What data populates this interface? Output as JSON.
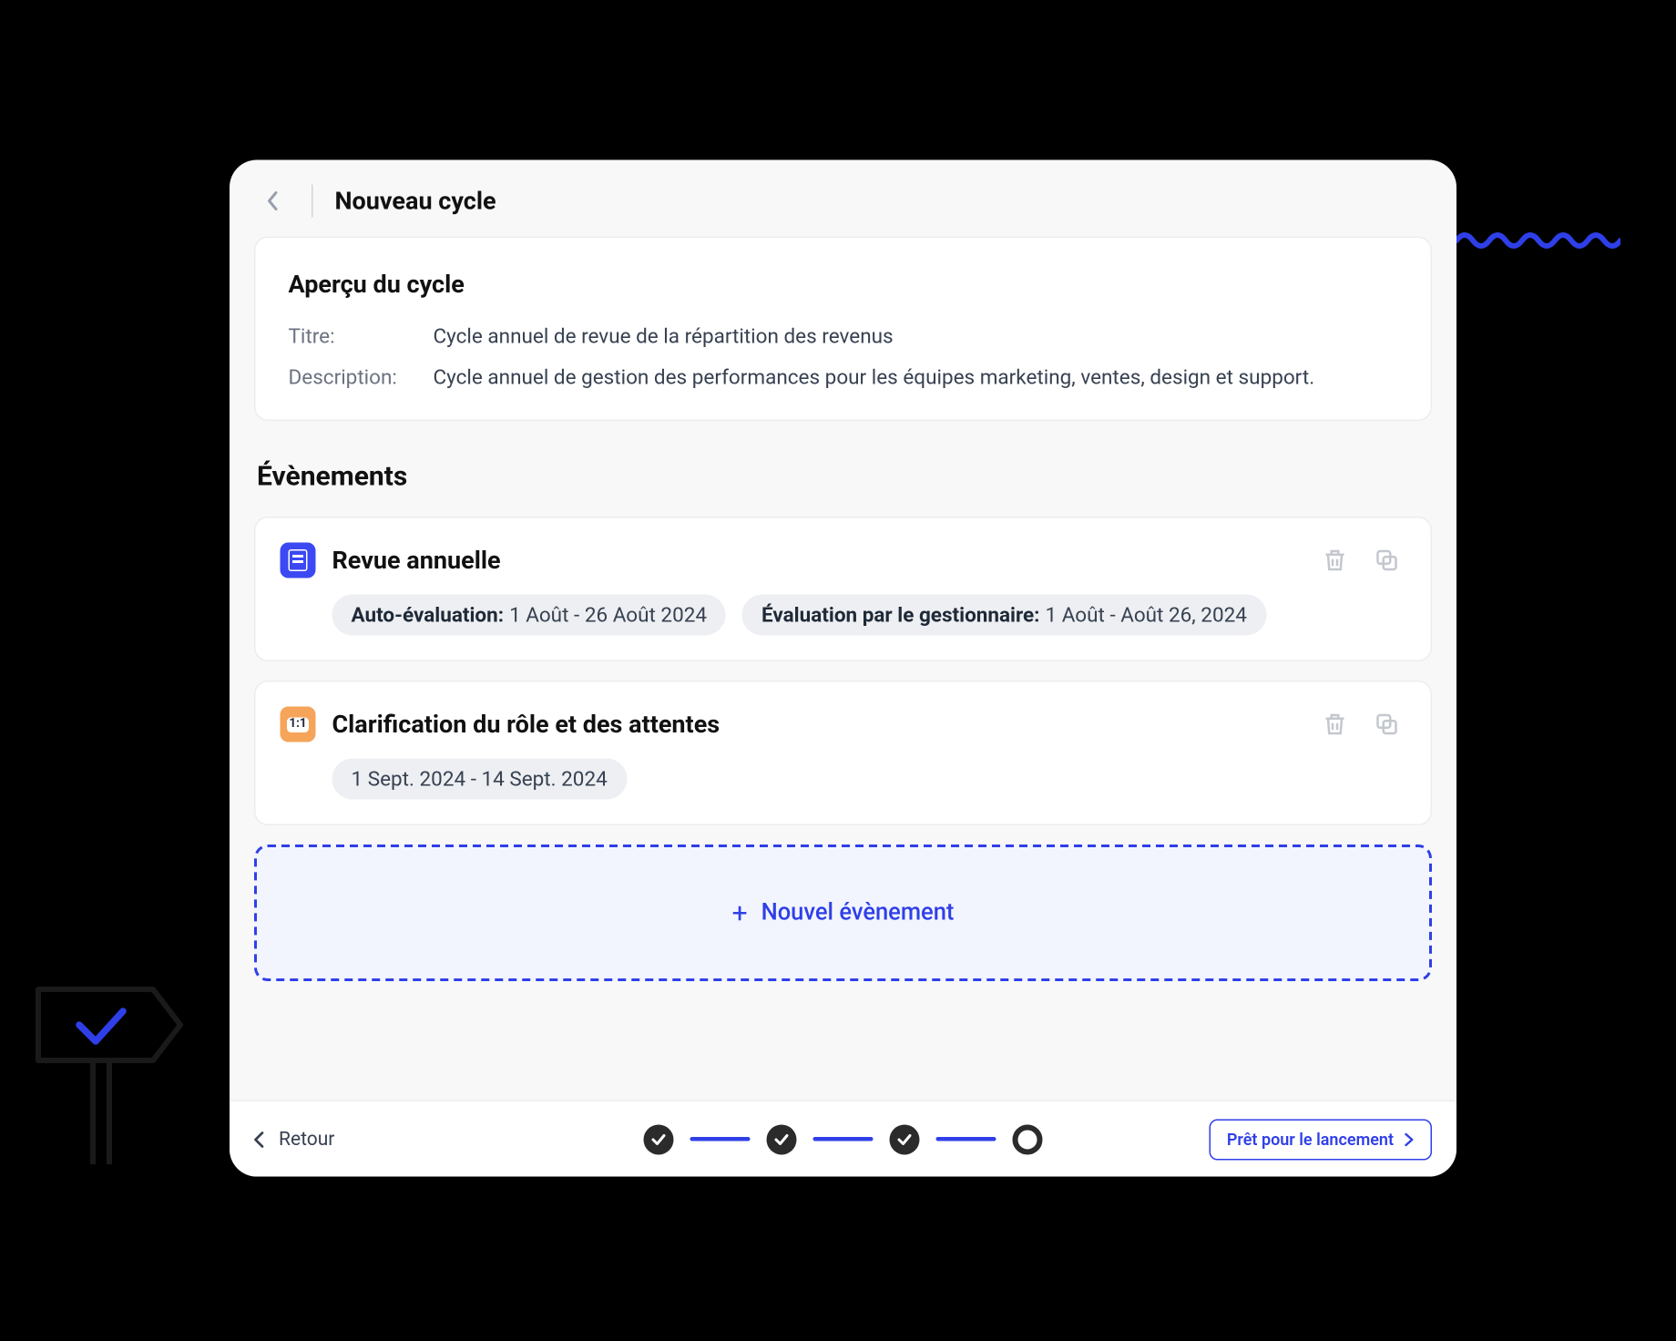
{
  "header": {
    "title": "Nouveau cycle"
  },
  "overview": {
    "heading": "Aperçu du cycle",
    "title_label": "Titre:",
    "title_value": "Cycle annuel de revue de la répartition des revenus",
    "description_label": "Description:",
    "description_value": "Cycle annuel de gestion des performances pour les équipes marketing, ventes, design et support."
  },
  "events": {
    "heading": "Évènements",
    "items": [
      {
        "title": "Revue annuelle",
        "pills": [
          {
            "key": "Auto-évaluation:",
            "value": "1 Août - 26 Août 2024"
          },
          {
            "key": "Évaluation par le gestionnaire:",
            "value": "1 Août - Août 26, 2024"
          }
        ]
      },
      {
        "title": "Clarification du rôle et des attentes",
        "pills": [
          {
            "key": "",
            "value": "1 Sept. 2024 - 14 Sept. 2024"
          }
        ]
      }
    ],
    "new_event_label": "Nouvel évènement"
  },
  "footer": {
    "back_label": "Retour",
    "ready_label": "Prêt pour le lancement"
  }
}
